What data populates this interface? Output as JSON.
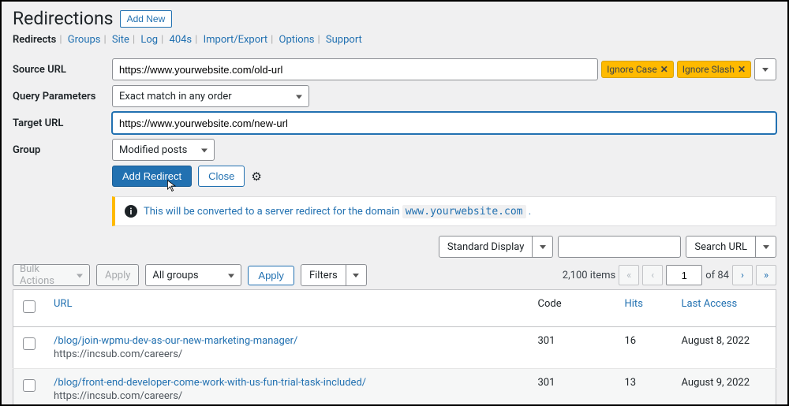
{
  "header": {
    "title": "Redirections",
    "add_new": "Add New"
  },
  "tabs": [
    "Redirects",
    "Groups",
    "Site",
    "Log",
    "404s",
    "Import/Export",
    "Options",
    "Support"
  ],
  "tabs_active": 0,
  "form": {
    "source_url": {
      "label": "Source URL",
      "value": "https://www.yourwebsite.com/old-url"
    },
    "flags": [
      {
        "label": "Ignore Case"
      },
      {
        "label": "Ignore Slash"
      }
    ],
    "query_params": {
      "label": "Query Parameters",
      "value": "Exact match in any order"
    },
    "target_url": {
      "label": "Target URL",
      "value": "https://www.yourwebsite.com/new-url"
    },
    "group": {
      "label": "Group",
      "value": "Modified posts"
    },
    "buttons": {
      "add": "Add Redirect",
      "close": "Close"
    }
  },
  "notice": {
    "text_before": "This will be converted to a server redirect for the domain ",
    "domain": "www.yourwebsite.com",
    "text_after": " ."
  },
  "toolbar1": {
    "display_mode": "Standard Display",
    "search_btn": "Search URL"
  },
  "toolbar2": {
    "bulk": "Bulk Actions",
    "apply": "Apply",
    "group_filter": "All groups",
    "apply2": "Apply",
    "filters": "Filters"
  },
  "pagination": {
    "total_items": "2,100 items",
    "current": "1",
    "of_text": "of 84",
    "first": "«",
    "prev": "‹",
    "next": "›",
    "last": "»"
  },
  "table": {
    "headers": {
      "url": "URL",
      "code": "Code",
      "hits": "Hits",
      "last": "Last Access"
    },
    "rows": [
      {
        "url": "/blog/join-wpmu-dev-as-our-new-marketing-manager/",
        "target": "https://incsub.com/careers/",
        "code": "301",
        "hits": "16",
        "last": "August 8, 2022"
      },
      {
        "url": "/blog/front-end-developer-come-work-with-us-fun-trial-task-included/",
        "target": "https://incsub.com/careers/",
        "code": "301",
        "hits": "13",
        "last": "August 9, 2022"
      }
    ]
  }
}
